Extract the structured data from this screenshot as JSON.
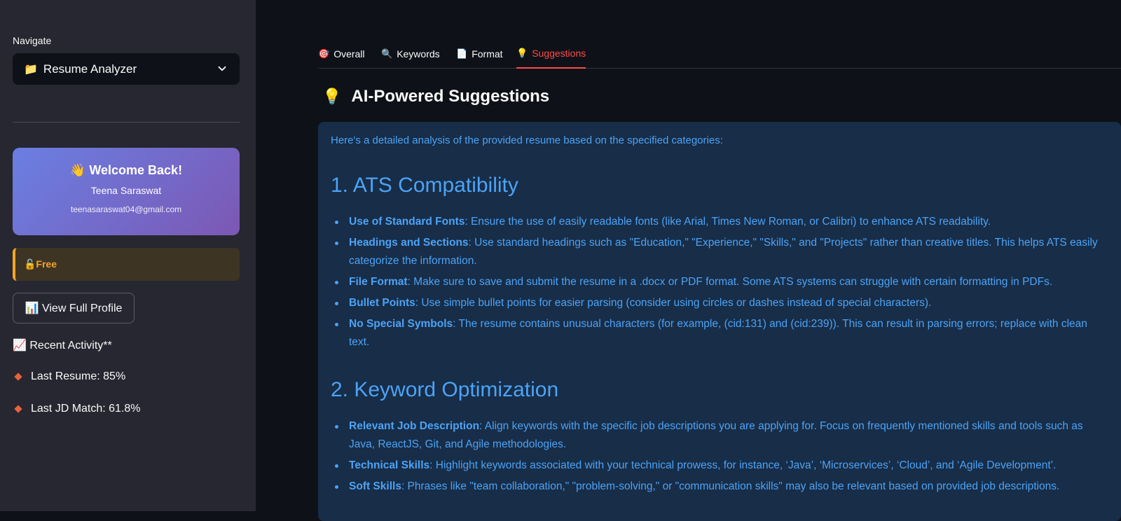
{
  "sidebar": {
    "nav_label": "Navigate",
    "nav_selected": "Resume Analyzer",
    "nav_icon": "folder-icon",
    "welcome": {
      "title": "👋 Welcome Back!",
      "name": "Teena Saraswat",
      "email": "teenasaraswat04@gmail.com"
    },
    "plan_label": "🔓Free",
    "profile_button": "📊 View Full Profile",
    "activity": {
      "title": "📈 Recent Activity**",
      "items": [
        {
          "label": "Last Resume: 85%"
        },
        {
          "label": "Last JD Match: 61.8%"
        }
      ]
    }
  },
  "tabs": [
    {
      "icon": "🎯",
      "label": "Overall",
      "active": false
    },
    {
      "icon": "🔍",
      "label": "Keywords",
      "active": false
    },
    {
      "icon": "📄",
      "label": "Format",
      "active": false
    },
    {
      "icon": "💡",
      "label": "Suggestions",
      "active": true
    }
  ],
  "main": {
    "heading_icon": "💡",
    "heading": "AI-Powered Suggestions",
    "intro": "Here's a detailed analysis of the provided resume based on the specified categories:",
    "sections": [
      {
        "title": "1. ATS Compatibility",
        "bullets": [
          {
            "term": "Use of Standard Fonts",
            "text": ": Ensure the use of easily readable fonts (like Arial, Times New Roman, or Calibri) to enhance ATS readability."
          },
          {
            "term": "Headings and Sections",
            "text": ": Use standard headings such as \"Education,\" \"Experience,\" \"Skills,\" and \"Projects\" rather than creative titles. This helps ATS easily categorize the information."
          },
          {
            "term": "File Format",
            "text": ": Make sure to save and submit the resume in a .docx or PDF format. Some ATS systems can struggle with certain formatting in PDFs."
          },
          {
            "term": "Bullet Points",
            "text": ": Use simple bullet points for easier parsing (consider using circles or dashes instead of special characters)."
          },
          {
            "term": "No Special Symbols",
            "text": ": The resume contains unusual characters (for example, (cid:131) and (cid:239)). This can result in parsing errors; replace with clean text."
          }
        ]
      },
      {
        "title": "2. Keyword Optimization",
        "bullets": [
          {
            "term": "Relevant Job Description",
            "text": ": Align keywords with the specific job descriptions you are applying for. Focus on frequently mentioned skills and tools such as Java, ReactJS, Git, and Agile methodologies."
          },
          {
            "term": "Technical Skills",
            "text": ": Highlight keywords associated with your technical prowess, for instance, ‘Java’, ‘Microservices’, ‘Cloud’, and ‘Agile Development’."
          },
          {
            "term": "Soft Skills",
            "text": ": Phrases like \"team collaboration,\" \"problem-solving,\" or \"communication skills\" may also be relevant based on provided job descriptions."
          }
        ]
      }
    ]
  }
}
